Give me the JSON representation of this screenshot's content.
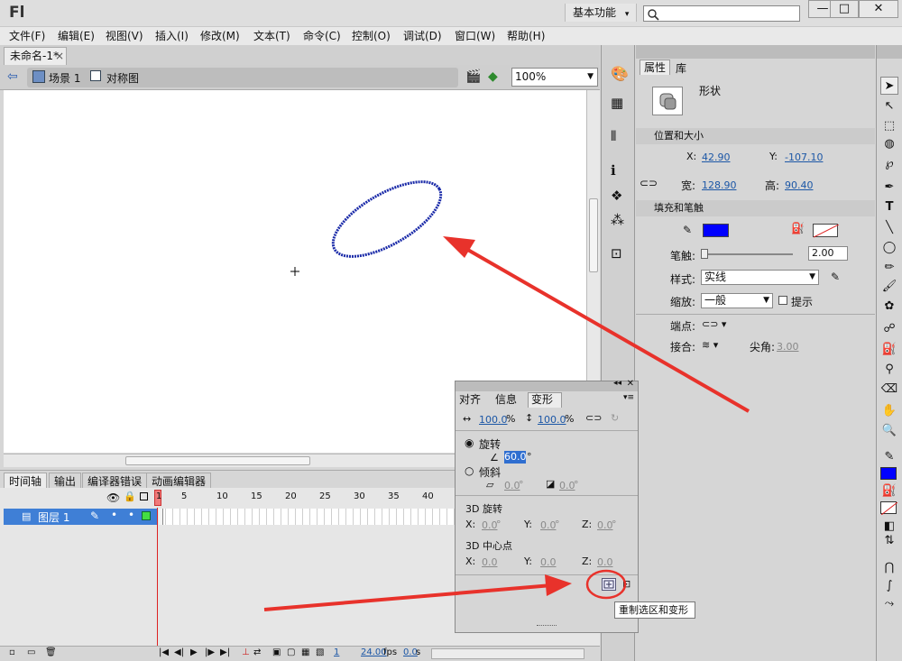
{
  "app": {
    "logo": "Fl",
    "workspace": "基本功能",
    "workspace_caret": "▾"
  },
  "window_buttons": {
    "minimize": "—",
    "maximize": "□",
    "close": "✕"
  },
  "menu": [
    "文件(F)",
    "编辑(E)",
    "视图(V)",
    "插入(I)",
    "修改(M)",
    "文本(T)",
    "命令(C)",
    "控制(O)",
    "调试(D)",
    "窗口(W)",
    "帮助(H)"
  ],
  "document": {
    "tab": "未命名-1*",
    "tab_close": "×"
  },
  "breadcrumb": {
    "scene": "场景 1",
    "symbol": "对称图"
  },
  "zoom": "100%",
  "timeline": {
    "tabs": [
      "时间轴",
      "输出",
      "编译器错误",
      "动画编辑器"
    ],
    "frame_numbers": [
      "1",
      "5",
      "10",
      "15",
      "20",
      "25",
      "30",
      "35",
      "40"
    ],
    "layer_name": "图层 1",
    "current_frame": "1",
    "fps": "24.00",
    "fps_unit": "fps",
    "time": "0.0",
    "time_unit": "s"
  },
  "properties": {
    "tabs": [
      "属性",
      "库"
    ],
    "object_type": "形状",
    "section_position": "位置和大小",
    "x_label": "X:",
    "x_value": "42.90",
    "y_label": "Y:",
    "y_value": "-107.10",
    "w_label": "宽:",
    "w_value": "128.90",
    "h_label": "高:",
    "h_value": "90.40",
    "section_fill": "填充和笔触",
    "stroke_color": "#0000ff",
    "stroke_label": "笔触:",
    "stroke_value": "2.00",
    "style_label": "样式:",
    "style_value": "实线",
    "scale_label": "缩放:",
    "scale_value": "一般",
    "hint_label": "提示",
    "cap_label": "端点:",
    "join_label": "接合:",
    "miter_label": "尖角:",
    "miter_value": "3.00"
  },
  "transform": {
    "tabs": [
      "对齐",
      "信息",
      "变形"
    ],
    "width_pct": "100.0",
    "height_pct": "100.0",
    "pct": "%",
    "rotate_label": "旋转",
    "rotate_value": "60.0",
    "degree": "°",
    "skew_label": "倾斜",
    "skew_h": "0.0",
    "skew_v": "0.0",
    "rot3d_label": "3D 旋转",
    "center3d_label": "3D 中心点",
    "x_label": "X:",
    "y_label": "Y:",
    "z_label": "Z:",
    "rot3d_x": "0.0",
    "rot3d_y": "0.0",
    "rot3d_z": "0.0",
    "c3d_x": "0.0",
    "c3d_y": "0.0",
    "c3d_z": "0.0",
    "tooltip": "重制选区和变形"
  },
  "colors": {
    "accent": "#1c57a6",
    "annotation": "#e8322b",
    "ellipse": "#1a2aa8",
    "layer_highlight": "#3f7fd6"
  }
}
